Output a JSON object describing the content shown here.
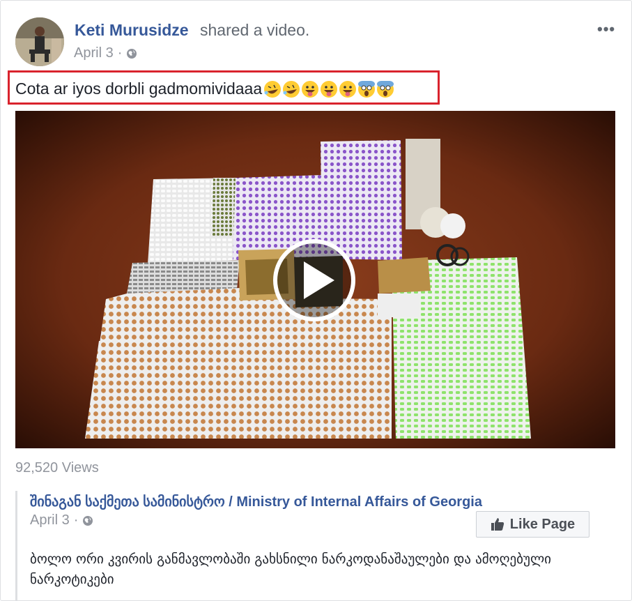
{
  "post": {
    "author": "Keti Murusidze",
    "action": "shared a video.",
    "date": "April 3",
    "dot": "·",
    "more": "•••",
    "text": "Cota ar iyos dorbli gadmomividaaa",
    "emojis": [
      "rofl",
      "rofl",
      "tongue",
      "tongue",
      "tongue",
      "scream",
      "scream"
    ],
    "views": "92,520 Views"
  },
  "shared": {
    "page_name": "შინაგან საქმეთა სამინისტრო / Ministry of Internal Affairs of Georgia",
    "date": "April 3",
    "dot": "·",
    "like_label": "Like Page",
    "description": "ბოლო ორი კვირის განმავლობაში გახსნილი ნარკოდანაშაულები და ამოღებული ნარკოტიკები"
  },
  "colors": {
    "link": "#365899",
    "highlight": "#d9232d",
    "muted": "#90949c"
  }
}
